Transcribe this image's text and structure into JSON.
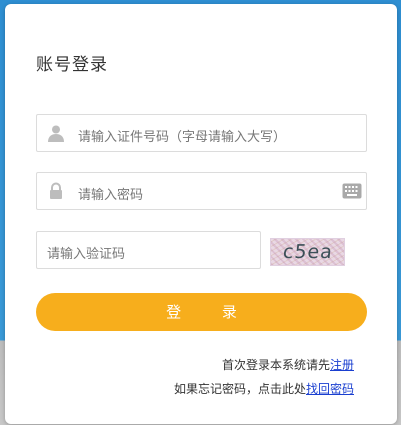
{
  "login": {
    "title": "账号登录",
    "id_placeholder": "请输入证件号码（字母请输入大写）",
    "password_placeholder": "请输入密码",
    "captcha_placeholder": "请输入验证码",
    "captcha_code": "c5ea",
    "submit_label": "登 录"
  },
  "footer": {
    "first_login_text": "首次登录本系统请先",
    "register_link": "注册",
    "forgot_text": "如果忘记密码，点击此处",
    "recover_link": "找回密码"
  },
  "colors": {
    "accent": "#f7ae1c",
    "link": "#1a3fd0",
    "background_top": "#2e8fd2"
  },
  "icons": {
    "id_field": "user-icon",
    "password_field": "lock-icon",
    "password_keyboard": "keyboard-icon"
  }
}
